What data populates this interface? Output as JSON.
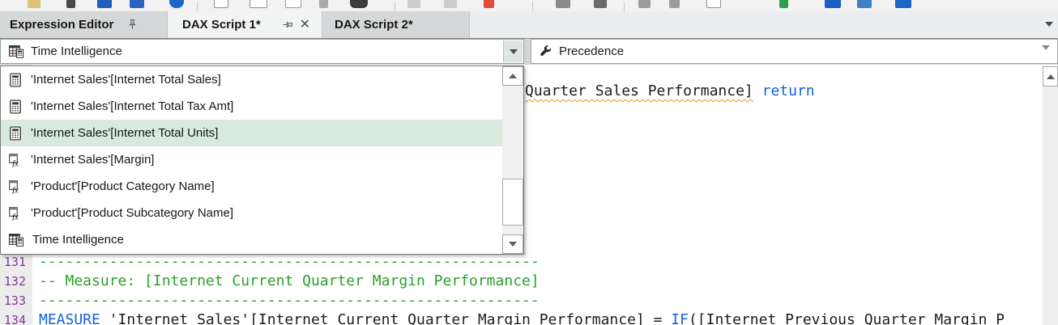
{
  "colors": {
    "hl": "#d8eadf",
    "green": "#2aa12a",
    "blue": "#1263d8",
    "purple": "#7d3c98",
    "squiggle": "#d9a300"
  },
  "tabs": {
    "items": [
      {
        "label": "Expression Editor",
        "pinned": true,
        "active": false
      },
      {
        "label": "DAX Script 1*",
        "pinned": false,
        "active": true,
        "closable": true
      },
      {
        "label": "DAX Script 2*",
        "pinned": false,
        "active": false
      }
    ]
  },
  "selectors": {
    "measure_picker": {
      "icon": "calculation-group-table-icon",
      "value": "Time Intelligence"
    },
    "property_picker": {
      "icon": "wrench-icon",
      "value": "Precedence"
    }
  },
  "dropdown": {
    "items": [
      {
        "icon": "measure-calculator-icon",
        "label": "'Internet Sales'[Internet Total Sales]",
        "highlighted": false
      },
      {
        "icon": "measure-calculator-icon",
        "label": "'Internet Sales'[Internet Total Tax Amt]",
        "highlighted": false
      },
      {
        "icon": "measure-calculator-icon",
        "label": "'Internet Sales'[Internet Total Units]",
        "highlighted": true
      },
      {
        "icon": "calculated-column-fx-icon",
        "label": "'Internet Sales'[Margin]",
        "highlighted": false
      },
      {
        "icon": "calculated-column-fx-icon",
        "label": "'Product'[Product Category Name]",
        "highlighted": false
      },
      {
        "icon": "calculated-column-fx-icon",
        "label": "'Product'[Product Subcategory Name]",
        "highlighted": false
      },
      {
        "icon": "calculation-group-table-icon",
        "label": "Time Intelligence",
        "highlighted": false
      }
    ]
  },
  "editor": {
    "partial_top_line": {
      "underlined_text": "Quarter Sales Performance]",
      "keyword": " return"
    },
    "lines": [
      {
        "num": "131",
        "comment": "---------------------------------------------------------"
      },
      {
        "num": "132",
        "comment": "-- Measure: [Internet Current Quarter Margin Performance]"
      },
      {
        "num": "133",
        "comment": "---------------------------------------------------------"
      },
      {
        "num": "134",
        "kw1": "MEASURE",
        "code1": " 'Internet Sales'[Internet Current Quarter Margin Performance] = ",
        "kw2": "IF",
        "code2": "([Internet Previous Quarter Margin P"
      }
    ]
  }
}
